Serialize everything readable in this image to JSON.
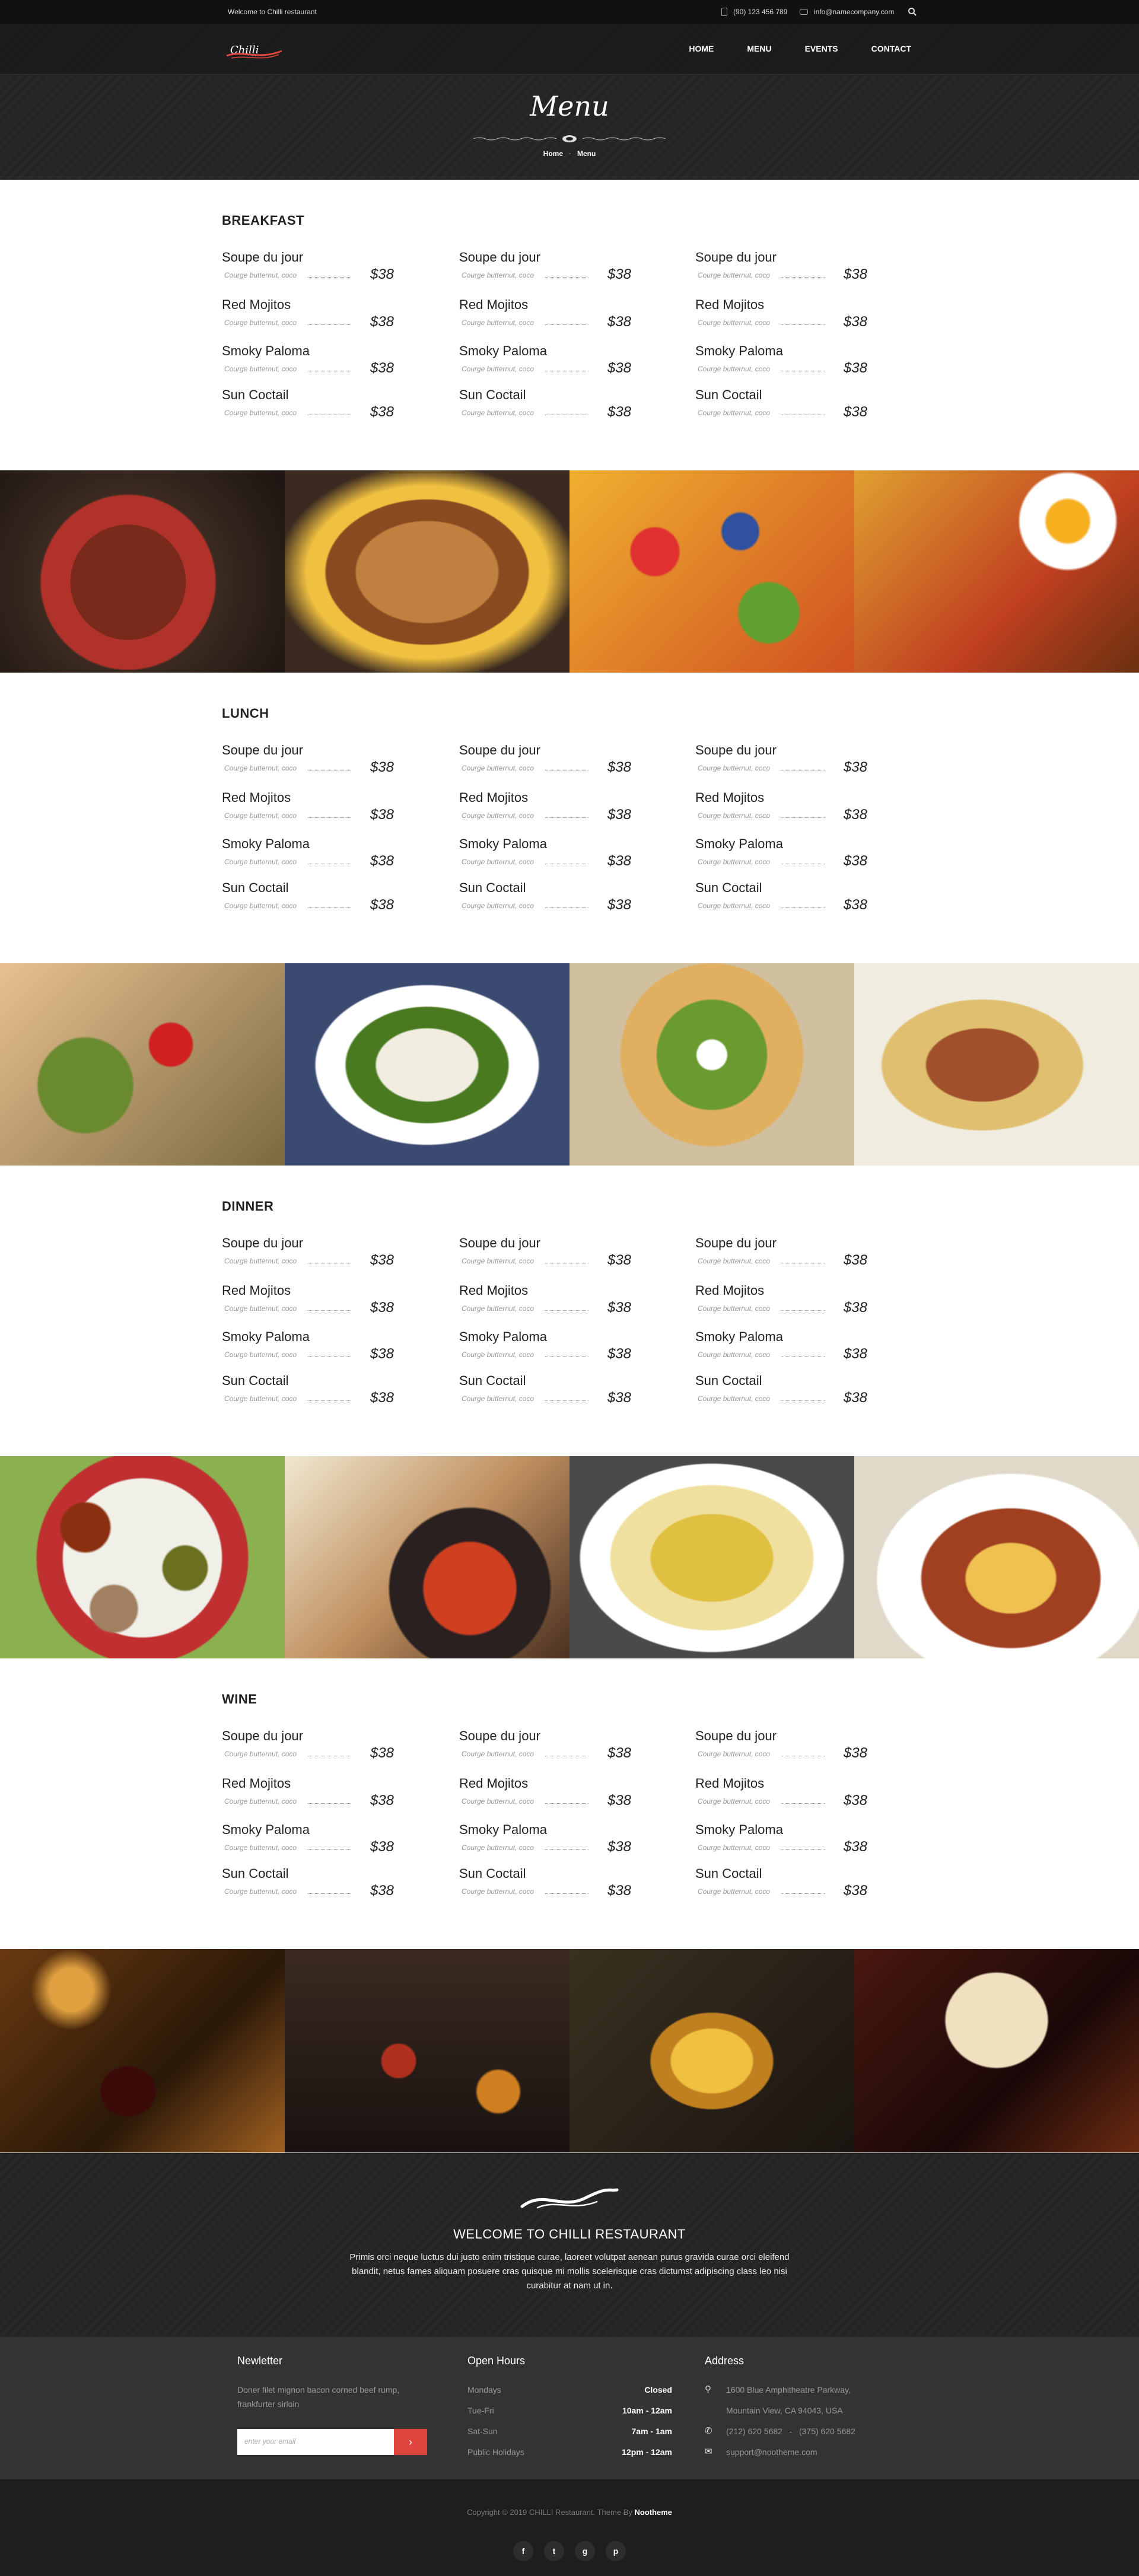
{
  "topbar": {
    "welcome": "Welcome to Chilli restaurant",
    "phone": "(90) 123 456 789",
    "email": "info@namecompany.com"
  },
  "nav": {
    "logo_text": "Chilli",
    "items": [
      "HOME",
      "MENU",
      "EVENTS",
      "CONTACT"
    ]
  },
  "page": {
    "title": "Menu",
    "breadcrumb": [
      "Home",
      "Menu"
    ]
  },
  "menu": {
    "sections": [
      {
        "title": "BREAKFAST",
        "columns": [
          [
            {
              "name": "Soupe du jour",
              "desc": "Courge butternut, coco",
              "price": "$38"
            },
            {
              "name": "Red Mojitos",
              "desc": "Courge butternut, coco",
              "price": "$38"
            },
            {
              "name": "Smoky Paloma",
              "desc": "Courge butternut, coco",
              "price": "$38"
            },
            {
              "name": "Sun Coctail",
              "desc": "Courge butternut, coco",
              "price": "$38"
            }
          ],
          [
            {
              "name": "Soupe du jour",
              "desc": "Courge butternut, coco",
              "price": "$38"
            },
            {
              "name": "Red Mojitos",
              "desc": "Courge butternut, coco",
              "price": "$38"
            },
            {
              "name": "Smoky Paloma",
              "desc": "Courge butternut, coco",
              "price": "$38"
            },
            {
              "name": "Sun Coctail",
              "desc": "Courge butternut, coco",
              "price": "$38"
            }
          ],
          [
            {
              "name": "Soupe du jour",
              "desc": "Courge butternut, coco",
              "price": "$38"
            },
            {
              "name": "Red Mojitos",
              "desc": "Courge butternut, coco",
              "price": "$38"
            },
            {
              "name": "Smoky Paloma",
              "desc": "Courge butternut, coco",
              "price": "$38"
            },
            {
              "name": "Sun Coctail",
              "desc": "Courge butternut, coco",
              "price": "$38"
            }
          ]
        ]
      },
      {
        "title": "LUNCH",
        "columns": [
          [
            {
              "name": "Soupe du jour",
              "desc": "Courge butternut, coco",
              "price": "$38"
            },
            {
              "name": "Red Mojitos",
              "desc": "Courge butternut, coco",
              "price": "$38"
            },
            {
              "name": "Smoky Paloma",
              "desc": "Courge butternut, coco",
              "price": "$38"
            },
            {
              "name": "Sun Coctail",
              "desc": "Courge butternut, coco",
              "price": "$38"
            }
          ],
          [
            {
              "name": "Soupe du jour",
              "desc": "Courge butternut, coco",
              "price": "$38"
            },
            {
              "name": "Red Mojitos",
              "desc": "Courge butternut, coco",
              "price": "$38"
            },
            {
              "name": "Smoky Paloma",
              "desc": "Courge butternut, coco",
              "price": "$38"
            },
            {
              "name": "Sun Coctail",
              "desc": "Courge butternut, coco",
              "price": "$38"
            }
          ],
          [
            {
              "name": "Soupe du jour",
              "desc": "Courge butternut, coco",
              "price": "$38"
            },
            {
              "name": "Red Mojitos",
              "desc": "Courge butternut, coco",
              "price": "$38"
            },
            {
              "name": "Smoky Paloma",
              "desc": "Courge butternut, coco",
              "price": "$38"
            },
            {
              "name": "Sun Coctail",
              "desc": "Courge butternut, coco",
              "price": "$38"
            }
          ]
        ]
      },
      {
        "title": "DINNER",
        "columns": [
          [
            {
              "name": "Soupe du jour",
              "desc": "Courge butternut, coco",
              "price": "$38"
            },
            {
              "name": "Red Mojitos",
              "desc": "Courge butternut, coco",
              "price": "$38"
            },
            {
              "name": "Smoky Paloma",
              "desc": "Courge butternut, coco",
              "price": "$38"
            },
            {
              "name": "Sun Coctail",
              "desc": "Courge butternut, coco",
              "price": "$38"
            }
          ],
          [
            {
              "name": "Soupe du jour",
              "desc": "Courge butternut, coco",
              "price": "$38"
            },
            {
              "name": "Red Mojitos",
              "desc": "Courge butternut, coco",
              "price": "$38"
            },
            {
              "name": "Smoky Paloma",
              "desc": "Courge butternut, coco",
              "price": "$38"
            },
            {
              "name": "Sun Coctail",
              "desc": "Courge butternut, coco",
              "price": "$38"
            }
          ],
          [
            {
              "name": "Soupe du jour",
              "desc": "Courge butternut, coco",
              "price": "$38"
            },
            {
              "name": "Red Mojitos",
              "desc": "Courge butternut, coco",
              "price": "$38"
            },
            {
              "name": "Smoky Paloma",
              "desc": "Courge butternut, coco",
              "price": "$38"
            },
            {
              "name": "Sun Coctail",
              "desc": "Courge butternut, coco",
              "price": "$38"
            }
          ]
        ]
      },
      {
        "title": "WINE",
        "columns": [
          [
            {
              "name": "Soupe du jour",
              "desc": "Courge butternut, coco",
              "price": "$38"
            },
            {
              "name": "Red Mojitos",
              "desc": "Courge butternut, coco",
              "price": "$38"
            },
            {
              "name": "Smoky Paloma",
              "desc": "Courge butternut, coco",
              "price": "$38"
            },
            {
              "name": "Sun Coctail",
              "desc": "Courge butternut, coco",
              "price": "$38"
            }
          ],
          [
            {
              "name": "Soupe du jour",
              "desc": "Courge butternut, coco",
              "price": "$38"
            },
            {
              "name": "Red Mojitos",
              "desc": "Courge butternut, coco",
              "price": "$38"
            },
            {
              "name": "Smoky Paloma",
              "desc": "Courge butternut, coco",
              "price": "$38"
            },
            {
              "name": "Sun Coctail",
              "desc": "Courge butternut, coco",
              "price": "$38"
            }
          ],
          [
            {
              "name": "Soupe du jour",
              "desc": "Courge butternut, coco",
              "price": "$38"
            },
            {
              "name": "Red Mojitos",
              "desc": "Courge butternut, coco",
              "price": "$38"
            },
            {
              "name": "Smoky Paloma",
              "desc": "Courge butternut, coco",
              "price": "$38"
            },
            {
              "name": "Sun Coctail",
              "desc": "Courge butternut, coco",
              "price": "$38"
            }
          ]
        ]
      }
    ]
  },
  "galleries": [
    {
      "photos": [
        "granola-bowl-photo",
        "breakfast-sandwich-photo",
        "fruit-salad-photo",
        "fried-eggs-photo"
      ]
    },
    {
      "photos": [
        "salad-photo",
        "salad-bowl-photo",
        "taco-salad-photo",
        "tacos-photo"
      ]
    },
    {
      "photos": [
        "salsa-platter-photo",
        "fajitas-photo",
        "nachos-photo",
        "enchiladas-photo"
      ]
    },
    {
      "photos": [
        "red-wine-glass-photo",
        "cocktails-bar-photo",
        "white-wine-glass-photo",
        "martini-glass-photo"
      ]
    }
  ],
  "welcome": {
    "title": "WELCOME TO CHILLI RESTAURANT",
    "text": "Primis orci neque luctus dui justo enim tristique curae, laoreet volutpat aenean purus gravida curae orci eleifend blandit, netus fames aliquam posuere cras quisque mi mollis scelerisque cras dictumst adipiscing class leo nisi curabitur at nam ut in."
  },
  "footer": {
    "newsletter": {
      "title": "Newletter",
      "text": "Doner filet mignon bacon corned beef rump, frankfurter sirloin",
      "placeholder": "enter your email",
      "button": "›"
    },
    "hours": {
      "title": "Open Hours",
      "rows": [
        {
          "day": "Mondays",
          "time": "Closed"
        },
        {
          "day": "Tue-Fri",
          "time": "10am - 12am"
        },
        {
          "day": "Sat-Sun",
          "time": "7am - 1am"
        },
        {
          "day": "Public Holidays",
          "time": "12pm - 12am"
        }
      ]
    },
    "address": {
      "title": "Address",
      "line1": "1600 Blue Amphitheatre Parkway,",
      "line2": "Mountain View, CA 94043, USA",
      "phones": "(212) 620 5682   -   (375) 620 5682",
      "email": "support@nootheme.com"
    },
    "copyright_prefix": "Copyright © 2019 CHILLI Restaurant. Theme By ",
    "copyright_brand": "Nootheme",
    "socials": [
      "f",
      "t",
      "g",
      "p"
    ]
  },
  "colors": {
    "accent": "#e0443f",
    "dark": "#252525"
  }
}
